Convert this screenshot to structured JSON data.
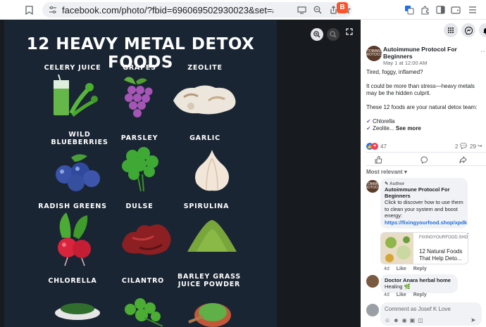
{
  "browser": {
    "url": "facebook.com/photo/?fbid=696069502930023&set=a.320532..."
  },
  "poster": {
    "title": "12 HEAVY METAL DETOX FOODS",
    "foods": [
      {
        "label": "CELERY JUICE"
      },
      {
        "label": "GRAPES"
      },
      {
        "label": "ZEOLITE"
      },
      {
        "label": "WILD\nBLUEBERRIES"
      },
      {
        "label": "PARSLEY"
      },
      {
        "label": "GARLIC"
      },
      {
        "label": "RADISH GREENS"
      },
      {
        "label": "DULSE"
      },
      {
        "label": "SPIRULINA"
      },
      {
        "label": "CHLORELLA"
      },
      {
        "label": "CILANTRO"
      },
      {
        "label": "BARLEY GRASS\nJUICE POWDER"
      }
    ]
  },
  "post": {
    "author": "Autoimmune Protocol For Beginners",
    "avatar_text": "AUTOIMMUNE PROTOCOL",
    "time": "May 1 at 12:00 AM",
    "lines": [
      "Tired, foggy, inflamed?",
      "It could be more than stress—heavy metals may be the hidden culprit.",
      "These 12 foods are your natural detox team:",
      "Chlorella",
      "Zeolite..."
    ],
    "see_more": "See more",
    "reaction_count": "47",
    "comment_count": "2",
    "share_count": "29",
    "sort_label": "Most relevant"
  },
  "comments": [
    {
      "badge": "Author",
      "author": "Autoimmune Protocol For Beginners",
      "body": "Click to discover how to use them to clean your system and boost energy:",
      "link": "https://fixingyourfood.shop/xpdk",
      "card_domain": "FIXINGYOURFOOD.SHOP",
      "card_title": "12 Natural Foods That Help Deto...",
      "time": "4d",
      "like": "Like",
      "reply": "Reply"
    },
    {
      "author": "Doctor Anara herbal home",
      "body": "Healing 🌿",
      "time": "4d",
      "like": "Like",
      "reply": "Reply"
    }
  ],
  "composer": {
    "placeholder": "Comment as Josef K Love"
  },
  "colors": {
    "poster_bg": "#1a2533",
    "link": "#216fdb",
    "brave": "#fb542b"
  }
}
